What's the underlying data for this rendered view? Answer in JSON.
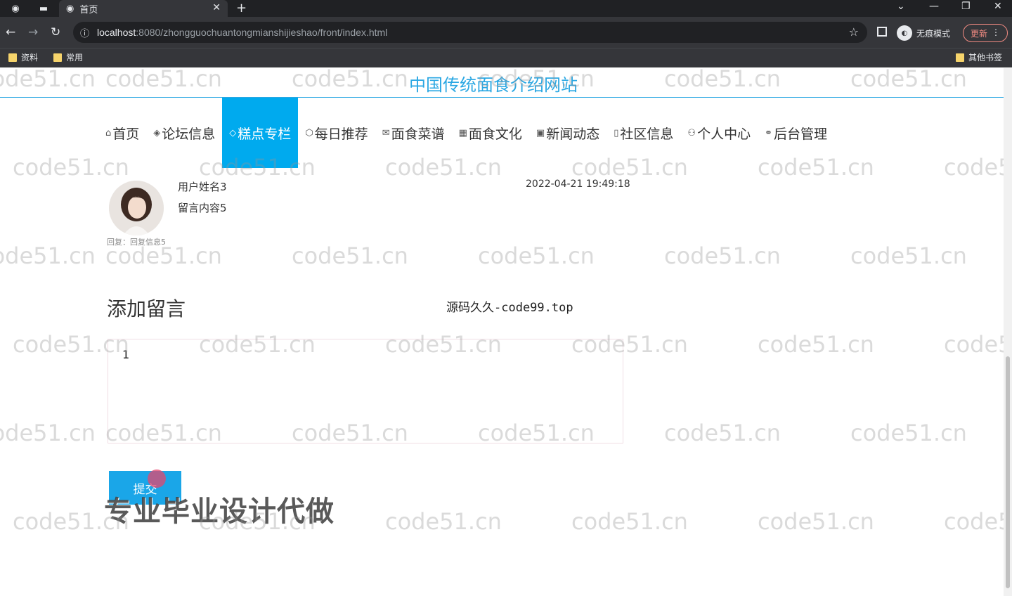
{
  "browser": {
    "tab_title": "首页",
    "url_host": "localhost",
    "url_rest": ":8080/zhongguochuantongmianshijieshao/front/index.html",
    "incognito_label": "无痕模式",
    "update_label": "更新",
    "bookmarks": [
      "资料",
      "常用"
    ],
    "other_bookmarks": "其他书签"
  },
  "site": {
    "title": "中国传统面食介绍网站"
  },
  "nav": [
    {
      "icon": "⌂",
      "label": "首页",
      "active": false
    },
    {
      "icon": "◈",
      "label": "论坛信息",
      "active": false
    },
    {
      "icon": "◇",
      "label": "糕点专栏",
      "active": true
    },
    {
      "icon": "⬡",
      "label": "每日推荐",
      "active": false
    },
    {
      "icon": "✉",
      "label": "面食菜谱",
      "active": false
    },
    {
      "icon": "▦",
      "label": "面食文化",
      "active": false
    },
    {
      "icon": "▣",
      "label": "新闻动态",
      "active": false
    },
    {
      "icon": "▯",
      "label": "社区信息",
      "active": false
    },
    {
      "icon": "⚇",
      "label": "个人中心",
      "active": false
    },
    {
      "icon": "⚭",
      "label": "后台管理",
      "active": false
    }
  ],
  "message": {
    "user": "用户姓名3",
    "content": "留言内容5",
    "time": "2022-04-21 19:49:18",
    "reply": "回复：回复信息5"
  },
  "form": {
    "title": "添加留言",
    "textarea_value": "1",
    "submit_label": "提交"
  },
  "overlay": {
    "source_note": "源码久久-code99.top",
    "promo": "专业毕业设计代做",
    "watermark": "code51.cn"
  }
}
